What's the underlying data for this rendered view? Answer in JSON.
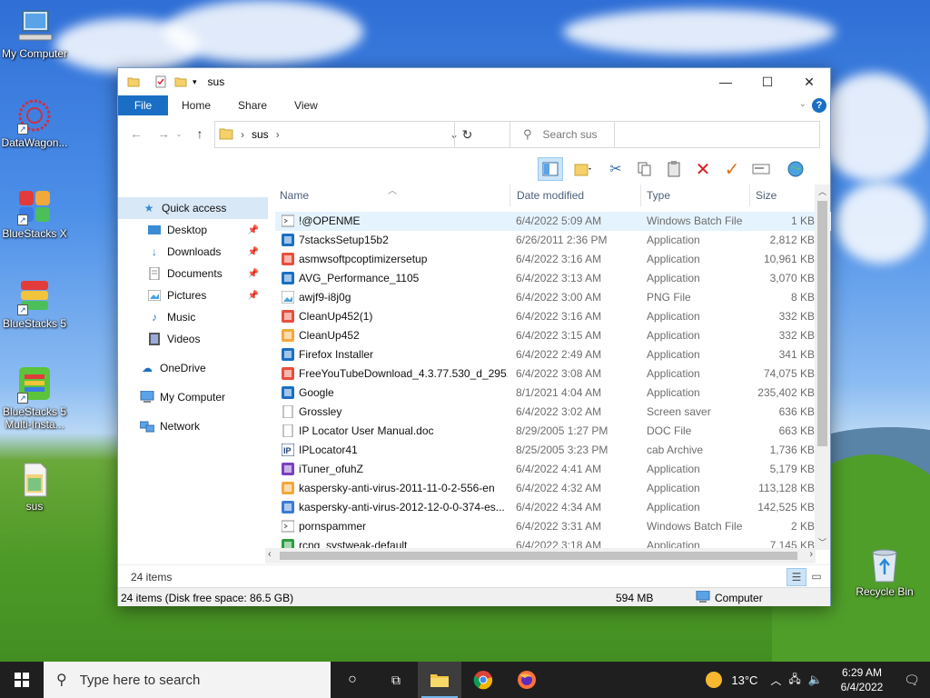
{
  "desktop": {
    "icons": [
      {
        "label": "My Computer",
        "icon": "computer-icon"
      },
      {
        "label": "DataWagon...",
        "icon": "datawagon-icon"
      },
      {
        "label": "BlueStacks X",
        "icon": "bluestacks-x-icon"
      },
      {
        "label": "BlueStacks 5",
        "icon": "bluestacks-5-icon"
      },
      {
        "label": "BlueStacks 5 Multi-Insta...",
        "icon": "bluestacks-multi-icon"
      },
      {
        "label": "sus",
        "icon": "folder-icon"
      },
      {
        "label": "Recycle Bin",
        "icon": "recycle-bin-icon"
      }
    ]
  },
  "window": {
    "title": "sus",
    "ribbon_tabs": [
      "File",
      "Home",
      "Share",
      "View"
    ],
    "address": {
      "crumb": "sus"
    },
    "search": {
      "placeholder": "Search sus"
    },
    "nav": [
      {
        "label": "Quick access",
        "icon": "star-icon"
      },
      {
        "label": "Desktop",
        "icon": "desktop-icon"
      },
      {
        "label": "Downloads",
        "icon": "download-icon"
      },
      {
        "label": "Documents",
        "icon": "documents-icon"
      },
      {
        "label": "Pictures",
        "icon": "pictures-icon"
      },
      {
        "label": "Music",
        "icon": "music-icon"
      },
      {
        "label": "Videos",
        "icon": "videos-icon"
      },
      {
        "label": "OneDrive",
        "icon": "cloud-icon"
      },
      {
        "label": "My Computer",
        "icon": "computer-icon"
      },
      {
        "label": "Network",
        "icon": "network-icon"
      }
    ],
    "columns": {
      "name": "Name",
      "date": "Date modified",
      "type": "Type",
      "size": "Size"
    },
    "files": [
      {
        "name": "!@OPENME",
        "date": "6/4/2022 5:09 AM",
        "type": "Windows Batch File",
        "size": "1 KB"
      },
      {
        "name": "7stacksSetup15b2",
        "date": "6/26/2011 2:36 PM",
        "type": "Application",
        "size": "2,812 KB"
      },
      {
        "name": "asmwsoftpcoptimizersetup",
        "date": "6/4/2022 3:16 AM",
        "type": "Application",
        "size": "10,961 KB"
      },
      {
        "name": "AVG_Performance_1105",
        "date": "6/4/2022 3:13 AM",
        "type": "Application",
        "size": "3,070 KB"
      },
      {
        "name": "awjf9-i8j0g",
        "date": "6/4/2022 3:00 AM",
        "type": "PNG File",
        "size": "8 KB"
      },
      {
        "name": "CleanUp452(1)",
        "date": "6/4/2022 3:16 AM",
        "type": "Application",
        "size": "332 KB"
      },
      {
        "name": "CleanUp452",
        "date": "6/4/2022 3:15 AM",
        "type": "Application",
        "size": "332 KB"
      },
      {
        "name": "Firefox Installer",
        "date": "6/4/2022 2:49 AM",
        "type": "Application",
        "size": "341 KB"
      },
      {
        "name": "FreeYouTubeDownload_4.3.77.530_d_295...",
        "date": "6/4/2022 3:08 AM",
        "type": "Application",
        "size": "74,075 KB"
      },
      {
        "name": "Google",
        "date": "8/1/2021 4:04 AM",
        "type": "Application",
        "size": "235,402 KB"
      },
      {
        "name": "Grossley",
        "date": "6/4/2022 3:02 AM",
        "type": "Screen saver",
        "size": "636 KB"
      },
      {
        "name": "IP Locator User Manual.doc",
        "date": "8/29/2005 1:27 PM",
        "type": "DOC File",
        "size": "663 KB"
      },
      {
        "name": "IPLocator41",
        "date": "8/25/2005 3:23 PM",
        "type": "cab Archive",
        "size": "1,736 KB"
      },
      {
        "name": "iTuner_ofuhZ",
        "date": "6/4/2022 4:41 AM",
        "type": "Application",
        "size": "5,179 KB"
      },
      {
        "name": "kaspersky-anti-virus-2011-11-0-2-556-en",
        "date": "6/4/2022 4:32 AM",
        "type": "Application",
        "size": "113,128 KB"
      },
      {
        "name": "kaspersky-anti-virus-2012-12-0-0-374-es...",
        "date": "6/4/2022 4:34 AM",
        "type": "Application",
        "size": "142,525 KB"
      },
      {
        "name": "pornspammer",
        "date": "6/4/2022 3:31 AM",
        "type": "Windows Batch File",
        "size": "2 KB"
      },
      {
        "name": "rcng_systweak-default",
        "date": "6/4/2022 3:18 AM",
        "type": "Application",
        "size": "7,145 KB"
      }
    ],
    "item_count": "24 items",
    "status": {
      "left": "24 items (Disk free space: 86.5 GB)",
      "mid": "594 MB",
      "right": "Computer"
    }
  },
  "taskbar": {
    "search_placeholder": "Type here to search",
    "weather": "13°C",
    "time": "6:29 AM",
    "date": "6/4/2022"
  }
}
